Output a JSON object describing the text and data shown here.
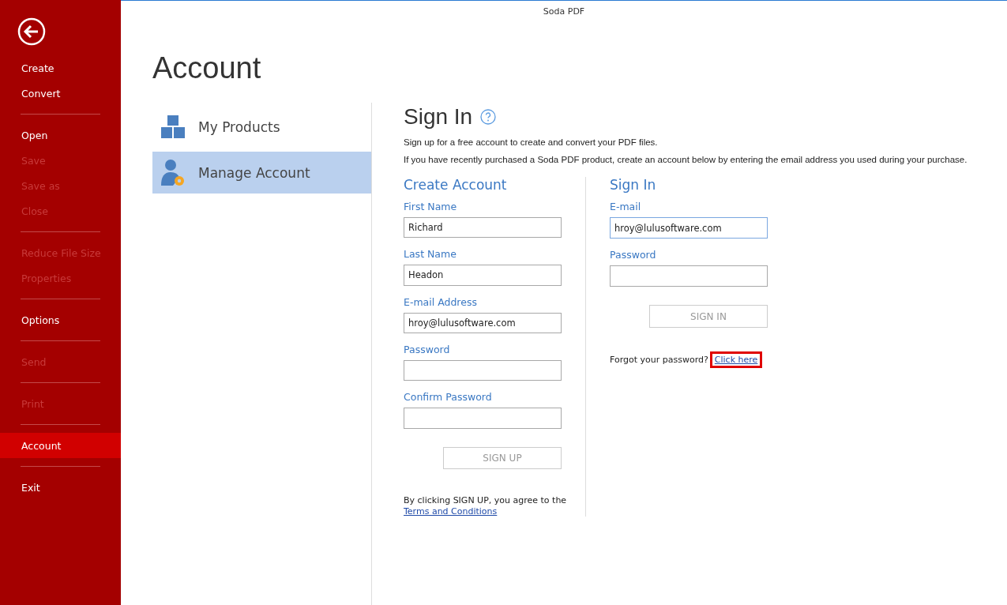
{
  "window": {
    "title": "Soda PDF"
  },
  "sidebar": {
    "items": [
      {
        "kind": "item",
        "label": "Create",
        "disabled": false,
        "selected": false
      },
      {
        "kind": "item",
        "label": "Convert",
        "disabled": false,
        "selected": false
      },
      {
        "kind": "divider"
      },
      {
        "kind": "item",
        "label": "Open",
        "disabled": false,
        "selected": false
      },
      {
        "kind": "item",
        "label": "Save",
        "disabled": true,
        "selected": false
      },
      {
        "kind": "item",
        "label": "Save as",
        "disabled": true,
        "selected": false
      },
      {
        "kind": "item",
        "label": "Close",
        "disabled": true,
        "selected": false
      },
      {
        "kind": "divider"
      },
      {
        "kind": "item",
        "label": "Reduce File Size",
        "disabled": true,
        "selected": false
      },
      {
        "kind": "item",
        "label": "Properties",
        "disabled": true,
        "selected": false
      },
      {
        "kind": "divider"
      },
      {
        "kind": "item",
        "label": "Options",
        "disabled": false,
        "selected": false
      },
      {
        "kind": "divider"
      },
      {
        "kind": "item",
        "label": "Send",
        "disabled": true,
        "selected": false
      },
      {
        "kind": "divider"
      },
      {
        "kind": "item",
        "label": "Print",
        "disabled": true,
        "selected": false
      },
      {
        "kind": "divider"
      },
      {
        "kind": "item",
        "label": "Account",
        "disabled": false,
        "selected": true
      },
      {
        "kind": "divider"
      },
      {
        "kind": "item",
        "label": "Exit",
        "disabled": false,
        "selected": false
      }
    ]
  },
  "page_title": "Account",
  "nav": [
    {
      "kind": "products",
      "label": "My Products",
      "selected": false
    },
    {
      "kind": "manage",
      "label": "Manage Account",
      "selected": true
    }
  ],
  "sign_in": {
    "title": "Sign In",
    "intro": "Sign up for a free account to create and convert your PDF files.",
    "note": "If you have recently purchased a Soda PDF product, create an account below by entering the email address you used during your purchase.",
    "create_account": {
      "title": "Create Account",
      "fields": [
        {
          "label": "First Name",
          "value": "Richard",
          "focused": false
        },
        {
          "label": "Last Name",
          "value": "Headon",
          "focused": false
        },
        {
          "label": "E-mail Address",
          "value": "hroy@lulusoftware.com",
          "focused": false
        },
        {
          "label": "Password",
          "focused": false
        },
        {
          "label": "Confirm Password",
          "focused": false
        }
      ],
      "button": "SIGN UP",
      "agreement": "By clicking SIGN UP, you agree to the",
      "terms_link": "Terms and Conditions"
    },
    "existing": {
      "title": "Sign In",
      "fields": [
        {
          "label": "E-mail",
          "value": "hroy@lulusoftware.com",
          "focused": true
        },
        {
          "label": "Password",
          "focused": false
        }
      ],
      "button": "SIGN IN",
      "forgot": "Forgot your password?",
      "forgot_link": {
        "label": "Click here",
        "highlighted": true
      }
    }
  }
}
